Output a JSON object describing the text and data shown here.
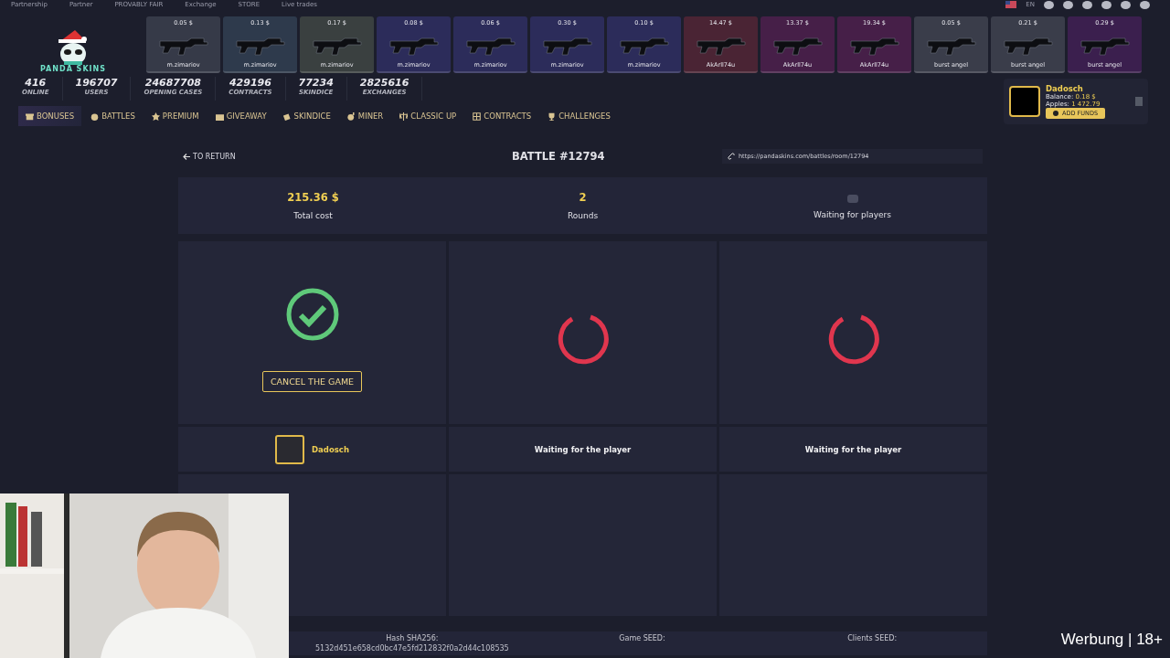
{
  "top_links": [
    "Partnership",
    "Partner",
    "PROVABLY FAIR",
    "Exchange",
    "STORE",
    "Live trades"
  ],
  "language": "EN",
  "logo": {
    "text": "PANDA SKINS"
  },
  "skins": [
    {
      "price": "0.05 $",
      "name": "m.zimariov",
      "color": "#363a48"
    },
    {
      "price": "0.13 $",
      "name": "m.zimariov",
      "color": "#2e3a4c"
    },
    {
      "price": "0.17 $",
      "name": "m.zimariov",
      "color": "#3a4040"
    },
    {
      "price": "0.08 $",
      "name": "m.zimariov",
      "color": "#2c2c5a"
    },
    {
      "price": "0.06 $",
      "name": "m.zimariov",
      "color": "#2c2c5a"
    },
    {
      "price": "0.30 $",
      "name": "m.zimariov",
      "color": "#2c2c5a"
    },
    {
      "price": "0.10 $",
      "name": "m.zimariov",
      "color": "#2c2c5a"
    },
    {
      "price": "14.47 $",
      "name": "AkArll74u",
      "color": "#4a2434"
    },
    {
      "price": "13.37 $",
      "name": "AkArll74u",
      "color": "#461f48"
    },
    {
      "price": "19.34 $",
      "name": "AkArll74u",
      "color": "#461f48"
    },
    {
      "price": "0.05 $",
      "name": "burst angel",
      "color": "#3a3d4a"
    },
    {
      "price": "0.21 $",
      "name": "burst angel",
      "color": "#3a3d4a"
    },
    {
      "price": "0.29 $",
      "name": "burst angel",
      "color": "#3b1f4e"
    }
  ],
  "stats": [
    {
      "value": "416",
      "label": "ONLINE"
    },
    {
      "value": "196707",
      "label": "USERS"
    },
    {
      "value": "24687708",
      "label": "OPENING CASES"
    },
    {
      "value": "429196",
      "label": "CONTRACTS"
    },
    {
      "value": "77234",
      "label": "SKINDICE"
    },
    {
      "value": "2825616",
      "label": "EXCHANGES"
    }
  ],
  "nav": [
    {
      "label": "BONUSES",
      "selected": true
    },
    {
      "label": "BATTLES",
      "selected": false
    },
    {
      "label": "PREMIUM",
      "selected": false
    },
    {
      "label": "GIVEAWAY",
      "selected": false
    },
    {
      "label": "SKINDICE",
      "selected": false
    },
    {
      "label": "MINER",
      "selected": false
    },
    {
      "label": "CLASSIC UP",
      "selected": false
    },
    {
      "label": "CONTRACTS",
      "selected": false
    },
    {
      "label": "CHALLENGES",
      "selected": false
    }
  ],
  "user": {
    "name": "Dadosch",
    "balance_label": "Balance:",
    "balance": "0.18 $",
    "apples_label": "Apples:",
    "apples": "1 472.79",
    "add_funds": "ADD FUNDS"
  },
  "battle": {
    "back": "TO RETURN",
    "title": "BATTLE #12794",
    "link": "https://pandaskins.com/battles/room/12794",
    "summary": [
      {
        "value": "215.36 $",
        "label": "Total cost"
      },
      {
        "value": "2",
        "label": "Rounds"
      },
      {
        "label": "Waiting for players"
      }
    ],
    "slots": [
      {
        "kind": "joined",
        "button": "CANCEL THE GAME",
        "player": "Dadosch"
      },
      {
        "kind": "waiting",
        "player": "Waiting for the player"
      },
      {
        "kind": "waiting",
        "player": "Waiting for the player"
      }
    ],
    "hash_label": "Hash SHA256:",
    "hash": "5132d451e658cd0bc47e5fd212832f0a2d44c108535",
    "game_seed_label": "Game SEED:",
    "clients_seed_label": "Clients SEED:"
  },
  "overlay": {
    "kind": "picture",
    "caption": "Werbung | 18+"
  }
}
